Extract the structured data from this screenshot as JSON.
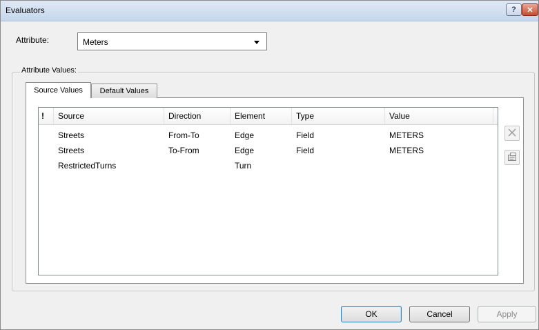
{
  "window": {
    "title": "Evaluators",
    "help_glyph": "?",
    "close_glyph": "✕"
  },
  "attribute": {
    "label": "Attribute:",
    "selected": "Meters"
  },
  "group": {
    "title": "Attribute Values:"
  },
  "tabs": [
    {
      "label": "Source Values",
      "active": true
    },
    {
      "label": "Default Values",
      "active": false
    }
  ],
  "grid": {
    "columns": [
      "!",
      "Source",
      "Direction",
      "Element",
      "Type",
      "Value"
    ],
    "rows": [
      {
        "source": "Streets",
        "direction": "From-To",
        "element": "Edge",
        "type": "Field",
        "value": "METERS"
      },
      {
        "source": "Streets",
        "direction": "To-From",
        "element": "Edge",
        "type": "Field",
        "value": "METERS"
      },
      {
        "source": "RestrictedTurns",
        "direction": "",
        "element": "Turn",
        "type": "",
        "value": ""
      }
    ]
  },
  "side_buttons": {
    "remove_icon": "remove-icon",
    "properties_icon": "properties-icon"
  },
  "buttons": {
    "ok": "OK",
    "cancel": "Cancel",
    "apply": "Apply"
  },
  "colors": {
    "titlebar": "#c6d7ec",
    "close_button": "#c74f33",
    "ok_border": "#3c7fb1"
  }
}
